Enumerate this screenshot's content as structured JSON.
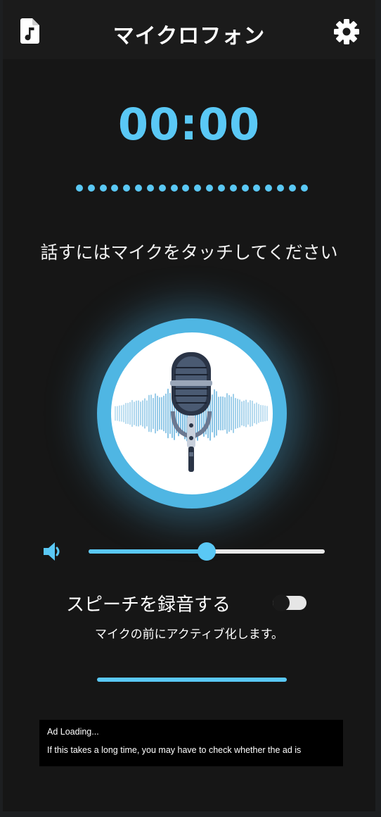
{
  "header": {
    "title": "マイクロフォン",
    "left_icon": "music-file-icon",
    "right_icon": "gear-icon"
  },
  "timer": {
    "text": "00:00"
  },
  "instruction": {
    "text": "話すにはマイクをタッチしてください"
  },
  "mic": {
    "icon": "microphone-icon"
  },
  "volume": {
    "icon": "speaker-icon",
    "level": 0.5
  },
  "recording": {
    "label": "スピーチを録音する",
    "enabled": false,
    "subtext": "マイクの前にアクティブ化します。"
  },
  "ad": {
    "line1": "Ad Loading...",
    "line2": "If this takes a long time, you may have to check whether the ad is"
  },
  "colors": {
    "accent": "#5ac8f5",
    "background": "#161616",
    "appbar": "#1b1b1b"
  }
}
